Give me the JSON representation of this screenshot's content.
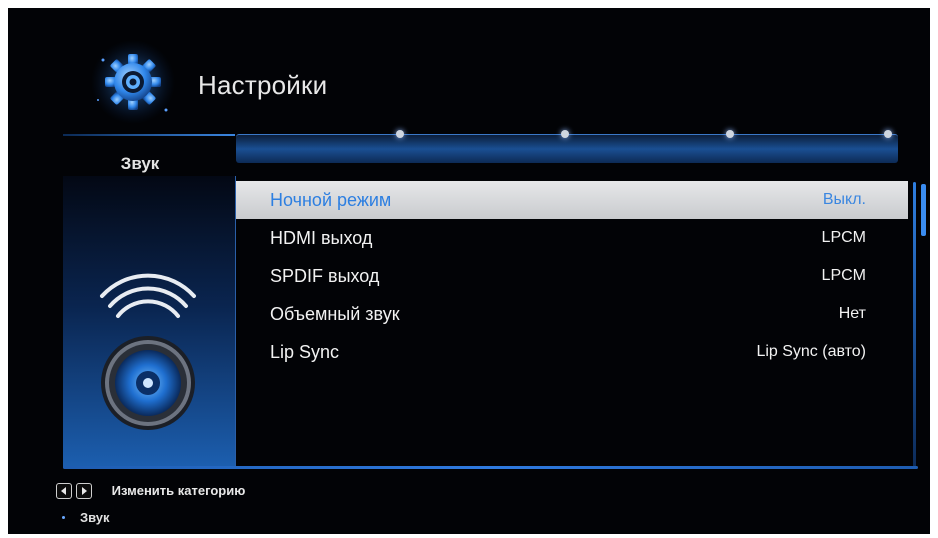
{
  "header": {
    "title": "Настройки",
    "icon": "gear-icon"
  },
  "category": {
    "label": "Звук",
    "icon": "speaker-icon"
  },
  "settings": [
    {
      "label": "Ночной режим",
      "value": "Выкл.",
      "selected": true
    },
    {
      "label": "HDMI выход",
      "value": "LPCM",
      "selected": false
    },
    {
      "label": "SPDIF выход",
      "value": "LPCM",
      "selected": false
    },
    {
      "label": "Объемный звук",
      "value": "Нет",
      "selected": false
    },
    {
      "label": "Lip Sync",
      "value": "Lip Sync (авто)",
      "selected": false
    }
  ],
  "footer": {
    "hint": "Изменить категорию",
    "current": "Звук",
    "left_key_icon": "left-arrow-key-icon",
    "right_key_icon": "right-arrow-key-icon"
  },
  "colors": {
    "accent": "#2d7fe1",
    "background": "#020306",
    "selected_row": "#dcdde0"
  }
}
